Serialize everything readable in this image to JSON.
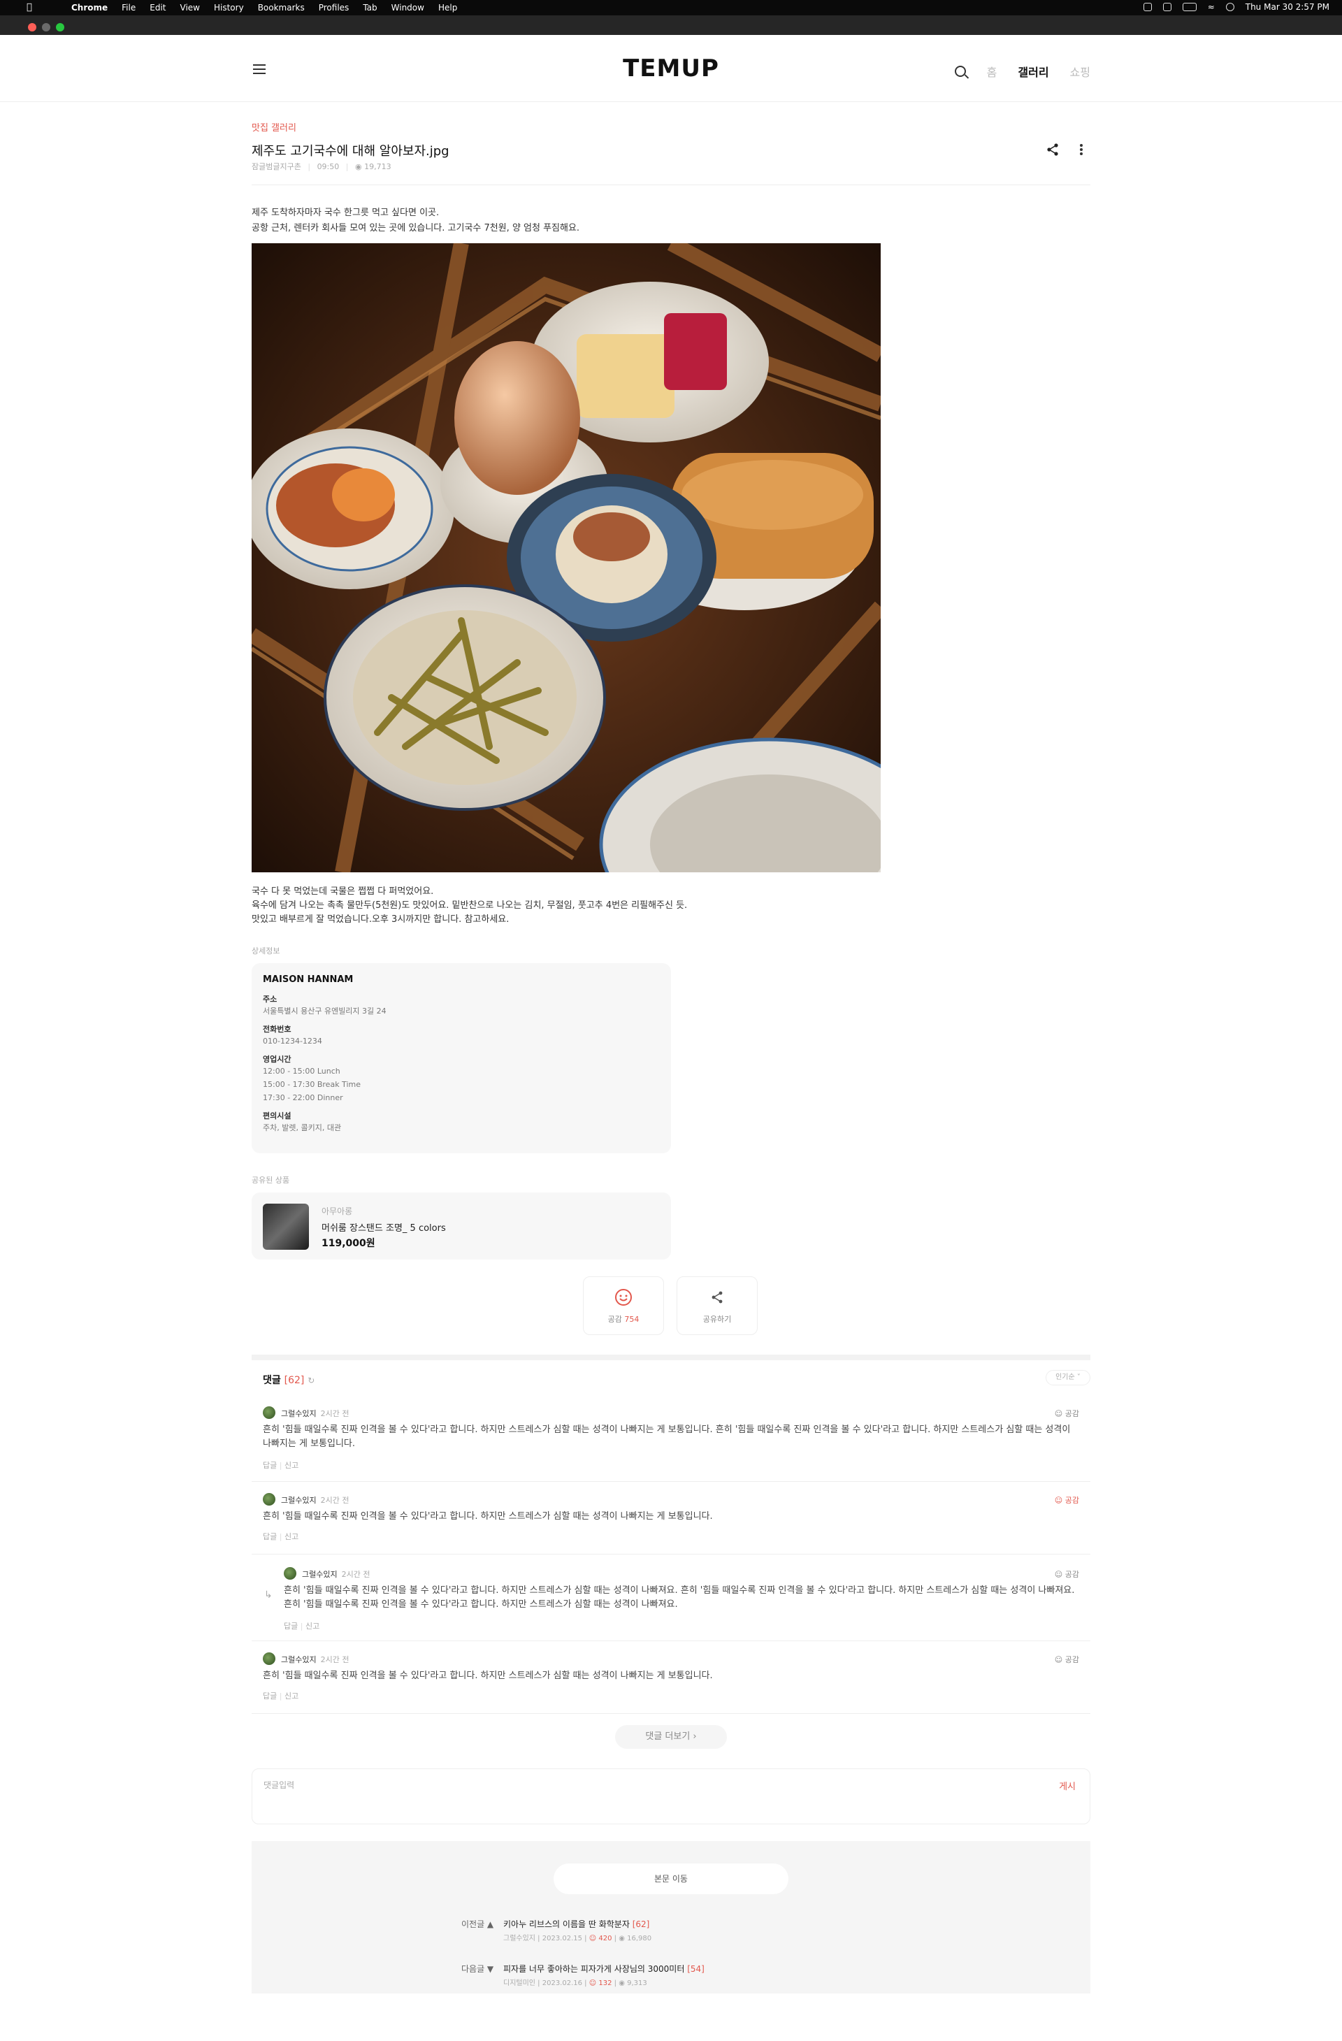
{
  "macos": {
    "app": "Chrome",
    "menus": [
      "Chrome",
      "File",
      "Edit",
      "View",
      "History",
      "Bookmarks",
      "Profiles",
      "Tab",
      "Window",
      "Help"
    ],
    "clock": "Thu Mar 30  2:57 PM"
  },
  "header": {
    "logo": "TEMUP",
    "nav": [
      "홈",
      "갤러리",
      "쇼핑"
    ]
  },
  "post": {
    "category": "맛집 갤러리",
    "title": "제주도 고기국수에 대해 알아보자.jpg",
    "author": "잠글범글지구촌",
    "time": "09:50",
    "views": "19,713",
    "intro": [
      "제주 도착하자마자 국수 한그릇 먹고 싶다면 이곳.",
      "공항 근처, 렌터카 회사들 모여 있는 곳에 있습니다. 고기국수 7천원, 양 엄청 푸짐해요."
    ],
    "body": [
      "국수 다 못 먹었는데 국물은 쩝쩝 다 퍼먹었어요.",
      "육수에 담겨 나오는 촉촉 물만두(5천원)도 맛있어요. 밑반찬으로 나오는 김치, 무절임, 풋고추 4번은 리필해주신 듯.",
      "맛있고 배부르게 잘 먹었습니다.오후 3시까지만 합니다. 참고하세요."
    ]
  },
  "detail": {
    "label": "상세정보",
    "name": "MAISON HANNAM",
    "addr_k": "주소",
    "addr_v": "서울특별시 용산구 유엔빌리지 3길 24",
    "tel_k": "전화번호",
    "tel_v": "010-1234-1234",
    "hours_k": "영업시간",
    "hours": [
      "12:00 - 15:00 Lunch",
      "15:00 - 17:30 Break Time",
      "17:30 - 22:00 Dinner"
    ],
    "fac_k": "편의시설",
    "fac_v": "주차, 발렛, 콜키지, 대관"
  },
  "shared": {
    "label": "공유된 상품",
    "brand": "아무아롱",
    "name": "머쉬룸 장스탠드 조명_ 5 colors",
    "price": "119,000원"
  },
  "actions": {
    "like_label": "공감",
    "like_count": "754",
    "share_label": "공유하기"
  },
  "comments": {
    "title": "댓글",
    "count": "[62]",
    "sort": "인기순",
    "like": "공감",
    "reply": "답글",
    "report": "신고",
    "items": [
      {
        "author": "그럴수있지",
        "time": "2시간 전",
        "text": "흔히 '힘들 때일수록 진짜 인격을 볼 수 있다'라고 합니다. 하지만 스트레스가 심할 때는 성격이 나빠지는 게 보통입니다. 흔히 '힘들 때일수록 진짜 인격을 볼 수 있다'라고 합니다. 하지만 스트레스가 심할 때는 성격이 나빠지는 게 보통입니다."
      },
      {
        "author": "그럴수있지",
        "time": "2시간 전",
        "text": "흔히 '힘들 때일수록 진짜 인격을 볼 수 있다'라고 합니다. 하지만 스트레스가 심할 때는 성격이 나빠지는 게 보통입니다."
      },
      {
        "author": "그럴수있지",
        "time": "2시간 전",
        "text": "흔히 '힘들 때일수록 진짜 인격을 볼 수 있다'라고 합니다. 하지만 스트레스가 심할 때는 성격이 나빠져요. 흔히 '힘들 때일수록 진짜 인격을 볼 수 있다'라고 합니다. 하지만 스트레스가 심할 때는 성격이 나빠져요. 흔히 '힘들 때일수록 진짜 인격을 볼 수 있다'라고 합니다. 하지만 스트레스가 심할 때는 성격이 나빠져요."
      },
      {
        "author": "그럴수있지",
        "time": "2시간 전",
        "text": "흔히 '힘들 때일수록 진짜 인격을 볼 수 있다'라고 합니다. 하지만 스트레스가 심할 때는 성격이 나빠지는 게 보통입니다."
      }
    ],
    "more": "댓글 더보기 ›",
    "input_placeholder": "댓글입력",
    "post": "게시"
  },
  "postnav": {
    "title": "본문 이동",
    "prev": {
      "label": "이전글 ▲",
      "title": "키아누 리브스의 이름을 딴 화학분자",
      "count": "[62]",
      "author": "그럴수있지",
      "date": "2023.02.15",
      "likes": "420",
      "views": "16,980"
    },
    "next": {
      "label": "다음글 ▼",
      "title": "피자를 너무 좋아하는 피자가게 사장님의 3000미터",
      "count": "[54]",
      "author": "디지털미인",
      "date": "2023.02.16",
      "likes": "132",
      "views": "9,313"
    }
  }
}
